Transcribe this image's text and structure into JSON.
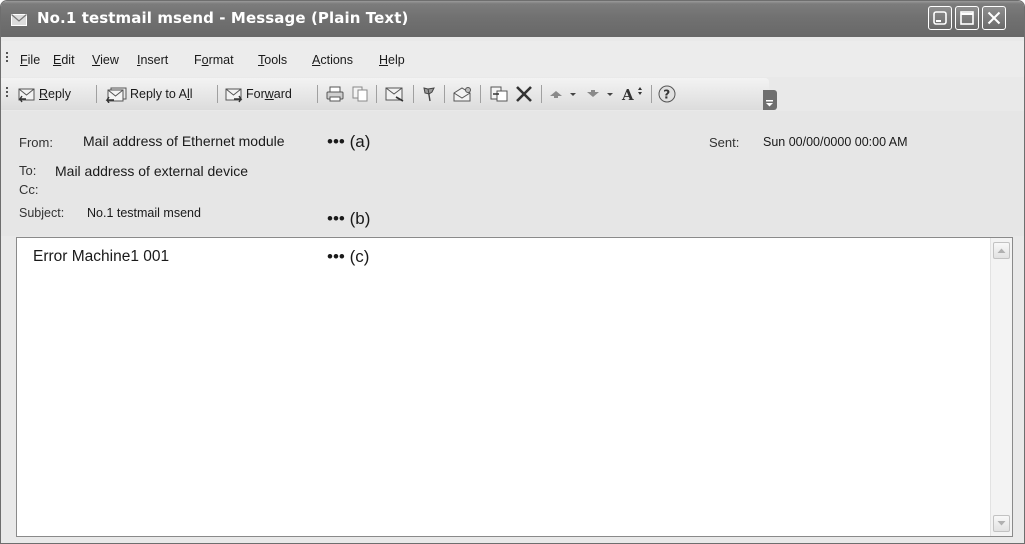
{
  "window": {
    "title": "No.1 testmail msend - Message (Plain Text)",
    "title_icon": "envelope-icon",
    "controls": [
      "minimize-icon",
      "maximize-icon",
      "close-icon"
    ]
  },
  "menubar": {
    "items": [
      {
        "pre": "",
        "ul": "F",
        "post": "ile"
      },
      {
        "pre": "",
        "ul": "E",
        "post": "dit"
      },
      {
        "pre": "",
        "ul": "V",
        "post": "iew"
      },
      {
        "pre": "",
        "ul": "I",
        "post": "nsert"
      },
      {
        "pre": "F",
        "ul": "o",
        "post": "rmat"
      },
      {
        "pre": "",
        "ul": "T",
        "post": "ools"
      },
      {
        "pre": "",
        "ul": "A",
        "post": "ctions"
      },
      {
        "pre": "",
        "ul": "H",
        "post": "elp"
      }
    ]
  },
  "toolbar": {
    "reply": {
      "pre": "",
      "ul": "R",
      "post": "eply"
    },
    "reply_all": {
      "pre": "Reply to A",
      "ul": "l",
      "post": "l"
    },
    "forward": {
      "pre": "For",
      "ul": "w",
      "post": "ard"
    }
  },
  "header": {
    "from_label": "From:",
    "from_value": "Mail address of Ethernet module",
    "to_label": "To:",
    "to_value": "Mail address of external device",
    "cc_label": "Cc:",
    "subject_label": "Subject:",
    "subject_value": "No.1 testmail msend",
    "sent_label": "Sent:",
    "sent_value": "Sun 00/00/0000 00:00 AM"
  },
  "annotations": {
    "a": "••• (a)",
    "b": "••• (b)",
    "c": "••• (c)"
  },
  "body": {
    "text": "Error Machine1 001"
  }
}
